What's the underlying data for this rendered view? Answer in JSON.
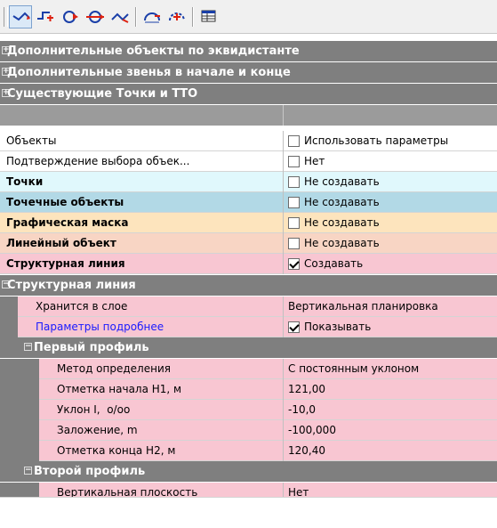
{
  "toolbar": {
    "buttons": [
      {
        "icon": "polyline-arrow-icon"
      },
      {
        "icon": "step-line-icon"
      },
      {
        "icon": "circle-arrow-icon"
      },
      {
        "icon": "circle-arrows-icon"
      },
      {
        "icon": "line-fork-icon"
      },
      {
        "icon": "arc-plus-icon"
      },
      {
        "icon": "arc-dashed-icon"
      },
      {
        "icon": "table-icon"
      }
    ]
  },
  "colors": {
    "category_bg": "#7f7f7f",
    "tochki": "#e0f8fc",
    "tochechnye": "#b2d9e6",
    "maska": "#fde4bd",
    "lineiny": "#f8d5c4",
    "struct": "#f8c6d2",
    "header_bg": "#9b9b9b"
  },
  "grid": {
    "cat_extra_objects": "Дополнительные объекты по эквидистанте",
    "cat_extra_links": "Дополнительные звенья в начале и конце",
    "cat_existing_points": "Существующие Точки и ТТО",
    "objects": {
      "label": "Объекты",
      "value": "Использовать параметры"
    },
    "confirm": {
      "label": "Подтверждение выбора объек...",
      "value": "Нет"
    },
    "tochki": {
      "label": "Точки",
      "value": "Не создавать"
    },
    "tochechnye": {
      "label": "Точечные объекты",
      "value": "Не создавать"
    },
    "maska": {
      "label": "Графическая маска",
      "value": "Не создавать"
    },
    "lineiny": {
      "label": "Линейный объект",
      "value": "Не создавать"
    },
    "struct_line": {
      "label": "Структурная линия",
      "value": "Создавать"
    },
    "cat_struct_line": "Структурная линия",
    "stored_in_layer": {
      "label": "Хранится в слое",
      "value": "Вертикальная планировка"
    },
    "params_more": {
      "label": "Параметры подробнее",
      "value": "Показывать"
    },
    "cat_first_profile": "Первый профиль",
    "method": {
      "label": "Метод определения",
      "value": "С постоянным уклоном"
    },
    "h1": {
      "label": "Отметка начала H1, м",
      "value": "121,00"
    },
    "slope": {
      "label": "Уклон I,  o/oo",
      "value": "-10,0"
    },
    "laying": {
      "label": "Заложение, m",
      "value": "-100,000"
    },
    "h2": {
      "label": "Отметка конца H2, м",
      "value": "120,40"
    },
    "cat_second_profile": "Второй профиль",
    "vertical_plane": {
      "label": "Вертикальная плоскость",
      "value": "Нет"
    }
  }
}
